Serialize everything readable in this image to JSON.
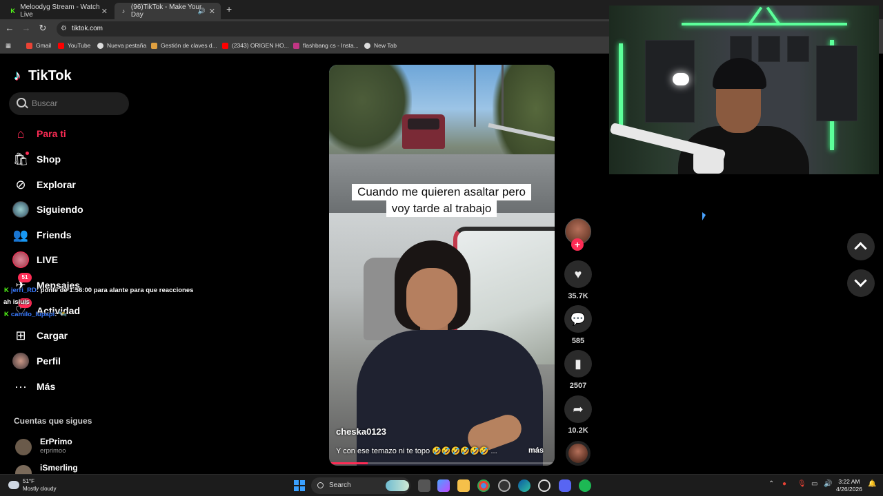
{
  "browser": {
    "tabs": [
      {
        "title": "Meloodyg Stream - Watch Live"
      },
      {
        "title": "(96)TikTok - Make Your Day"
      }
    ],
    "new_tab_symbol": "+",
    "address": "tiktok.com",
    "bookmarks": [
      {
        "label": "Gmail",
        "color": "#ea4335"
      },
      {
        "label": "YouTube",
        "color": "#ff0000"
      },
      {
        "label": "Nueva pestaña",
        "color": "#dddddd"
      },
      {
        "label": "Gestión de claves d...",
        "color": "#e0a040"
      },
      {
        "label": "(2343) ORIGEN HO...",
        "color": "#ff0000"
      },
      {
        "label": "flashbang cs - Insta...",
        "color": "#c13584"
      },
      {
        "label": "New Tab",
        "color": "#dddddd"
      }
    ]
  },
  "tiktok": {
    "logo_text": "TikTok",
    "search_placeholder": "Buscar",
    "nav": [
      {
        "label": "Para ti",
        "icon": "home-icon",
        "active": true
      },
      {
        "label": "Shop",
        "icon": "shop-icon"
      },
      {
        "label": "Explorar",
        "icon": "compass-icon"
      },
      {
        "label": "Siguiendo",
        "icon": "avatar"
      },
      {
        "label": "Friends",
        "icon": "friends-icon"
      },
      {
        "label": "LIVE",
        "icon": "live-avatar"
      },
      {
        "label": "Mensajes",
        "icon": "messages-icon",
        "badge": "51"
      },
      {
        "label": "Actividad",
        "icon": "activity-icon",
        "badge": "45"
      },
      {
        "label": "Cargar",
        "icon": "upload-icon"
      },
      {
        "label": "Perfil",
        "icon": "profile-avatar"
      },
      {
        "label": "Más",
        "icon": "more-icon"
      }
    ],
    "following_title": "Cuentas que sigues",
    "following": [
      {
        "name": "ErPrimo",
        "handle": "erprimoo"
      },
      {
        "name": "iSmerling",
        "handle": ""
      }
    ],
    "video": {
      "caption_line1": "Cuando me quieren asaltar pero",
      "caption_line2": "voy tarde al trabajo",
      "username": "cheska0123",
      "description": "Y con ese temazo ni te topo 🤣🤣🤣🤣🤣🤣 ...",
      "more_label": "más",
      "progress": 0.17
    },
    "actions": {
      "likes": "35.7K",
      "comments": "585",
      "saves": "2507",
      "shares": "10.2K",
      "follow_symbol": "+"
    }
  },
  "chat": [
    {
      "user": "jerri_RD",
      "message": ": ponle de 1:56:00 para alante para que reacciones"
    },
    {
      "user": "",
      "message": "ah isluis"
    },
    {
      "user": "camilo_lupapi",
      "message": ": 🛰️"
    }
  ],
  "taskbar": {
    "temperature": "51°F",
    "weather": "Mostly cloudy",
    "search_label": "Search",
    "time": "3:22 AM",
    "date": "4/26/2026"
  },
  "colors": {
    "accent": "#fe2c55",
    "kick_green": "#53fc18",
    "chat_user": "#3a7bff"
  }
}
